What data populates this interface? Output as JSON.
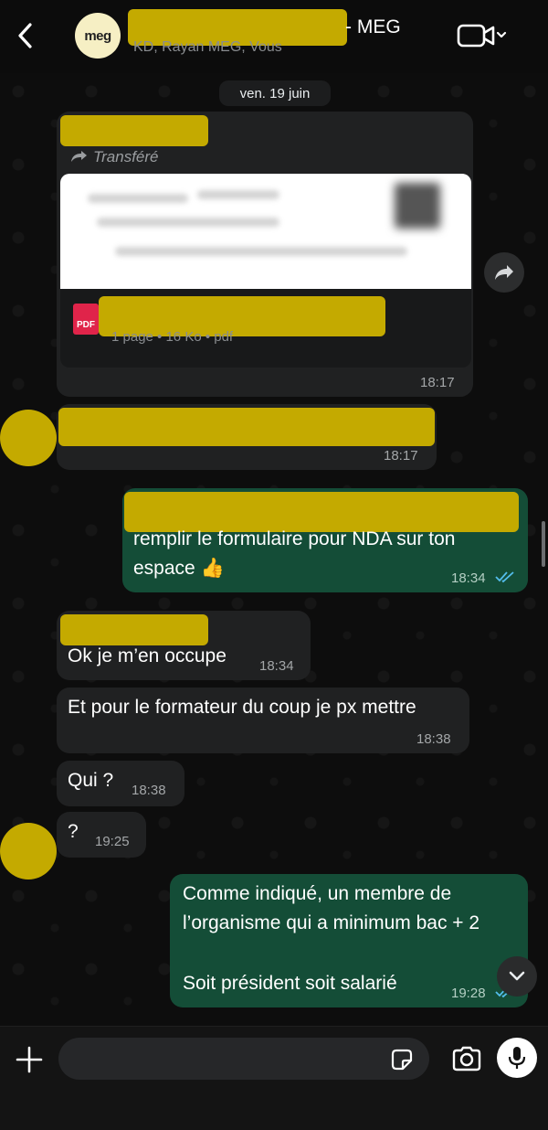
{
  "header": {
    "avatar_text": "meg",
    "title_suffix": "- MEG",
    "subtitle": "KD, Rayan MEG, Vous",
    "icons": {
      "back": "chevron-left-icon",
      "video": "video-camera-icon",
      "dropdown": "chevron-down-icon"
    }
  },
  "date_chip": "ven. 19 juin",
  "messages": {
    "forwarded_doc": {
      "forward_label": "Transféré",
      "pdf_label": "PDF",
      "meta": "1 page • 16 Ko • pdf",
      "time": "18:17"
    },
    "msg2": {
      "time": "18:17"
    },
    "msg3": {
      "line1": "remplir le formulaire pour NDA sur ton",
      "line2": "espace 👍",
      "time": "18:34"
    },
    "msg4": {
      "text": "Ok je m’en occupe",
      "time": "18:34"
    },
    "msg5": {
      "text": "Et pour le formateur du coup je px mettre",
      "time": "18:38"
    },
    "msg6": {
      "text": "Qui ?",
      "time": "18:38"
    },
    "msg7": {
      "text": "?",
      "time": "19:25"
    },
    "msg8": {
      "line1": "Comme indiqué, un membre de",
      "line2": "l’organisme qui a minimum bac + 2",
      "line3": "Soit président soit salarié",
      "time": "19:28"
    }
  },
  "input": {
    "placeholder": ""
  },
  "colors": {
    "incoming_bubble": "#202122",
    "outgoing_bubble": "#144d37",
    "redaction": "#c4aa00",
    "read_ticks": "#53bdeb"
  }
}
